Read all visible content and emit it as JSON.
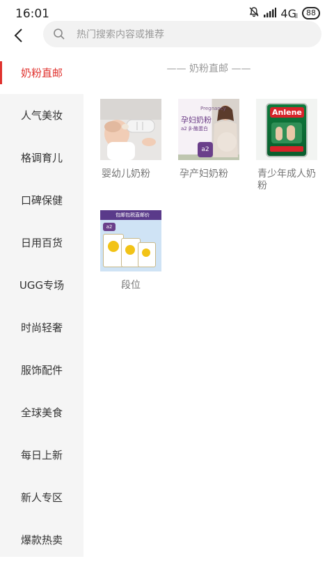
{
  "status": {
    "time": "16:01",
    "network": "4G",
    "network_sub": "ll",
    "battery": "88"
  },
  "search": {
    "placeholder": "热门搜索内容或推荐"
  },
  "sidebar": {
    "items": [
      {
        "label": "奶粉直邮"
      },
      {
        "label": "人气美妆"
      },
      {
        "label": "格调育儿"
      },
      {
        "label": "口碑保健"
      },
      {
        "label": "日用百货"
      },
      {
        "label": "UGG专场"
      },
      {
        "label": "时尚轻奢"
      },
      {
        "label": "服饰配件"
      },
      {
        "label": "全球美食"
      },
      {
        "label": "每日上新"
      },
      {
        "label": "新人专区"
      },
      {
        "label": "爆款热卖"
      }
    ],
    "active_index": 0
  },
  "content": {
    "section_title": "—— 奶粉直邮 ——",
    "products": [
      {
        "label": "婴幼儿奶粉"
      },
      {
        "label": "孕产妇奶粉",
        "thumb_text_top": "Pregnancy",
        "thumb_text_main": "孕妇奶粉",
        "thumb_text_sub": "a2 β-酪蛋白"
      },
      {
        "label": "青少年成人奶粉",
        "thumb_brand": "Anlene"
      },
      {
        "label": "段位",
        "thumb_banner": "包邮包税直邮价"
      }
    ]
  },
  "colors": {
    "accent": "#e0322e",
    "sidebar_bg": "#f5f5f5"
  }
}
